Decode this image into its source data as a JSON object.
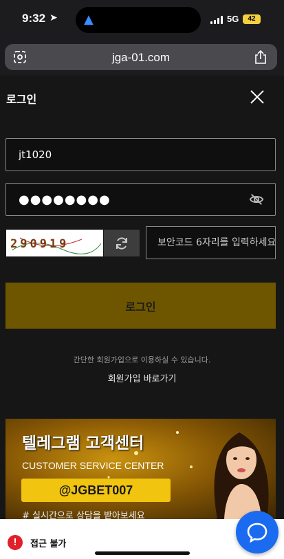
{
  "status_bar": {
    "time": "9:32",
    "network": "5G",
    "battery": "42"
  },
  "browser": {
    "url": "jga-01.com"
  },
  "login": {
    "title": "로그인",
    "id_value": "jt1020",
    "password_value": "●●●●●●●●",
    "captcha_text": "290919",
    "code_placeholder": "보안코드 6자리를 입력하세요",
    "submit_label": "로그인",
    "signup_note": "간단한 회원가입으로 이용하실 수 있습니다.",
    "signup_link": "회원가입 바로가기"
  },
  "banner": {
    "title": "텔레그램 고객센터",
    "subtitle": "CUSTOMER SERVICE CENTER",
    "handle": "@JGBET007",
    "bottom_text": "# 실시간으로 상담을 받아보세요"
  },
  "bottom_bar": {
    "text": "접근 불가",
    "alert_symbol": "!"
  },
  "colors": {
    "accent": "#6e5600",
    "background": "#161616",
    "chat": "#1b6bf0",
    "alert": "#e0202a"
  }
}
